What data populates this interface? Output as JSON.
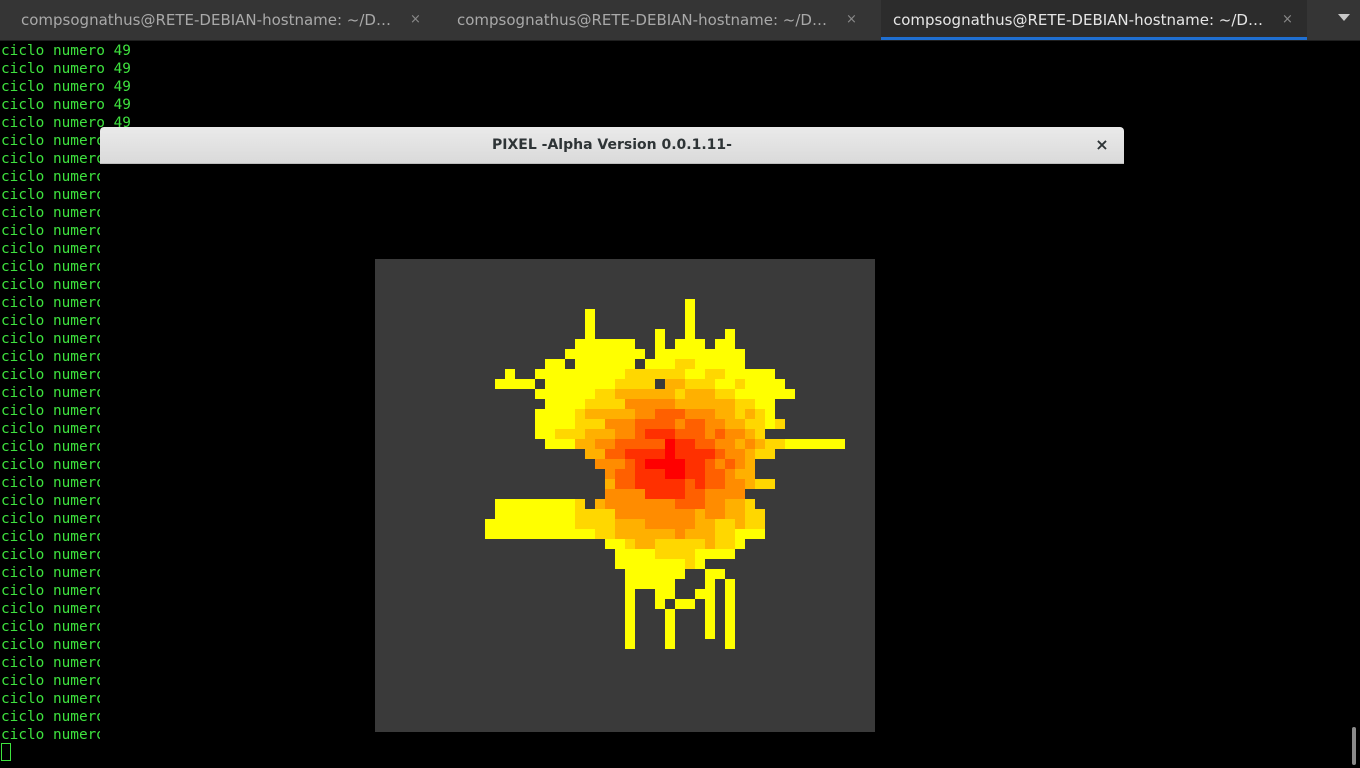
{
  "tabs": [
    {
      "title": "compsognathus@RETE-DEBIAN-hostname: ~/Docume…",
      "close": "×",
      "active": false
    },
    {
      "title": "compsognathus@RETE-DEBIAN-hostname: ~/Docume…",
      "close": "×",
      "active": false
    },
    {
      "title": "compsognathus@RETE-DEBIAN-hostname: ~/Docume…",
      "close": "×",
      "active": true
    }
  ],
  "terminal": {
    "line_text": "ciclo numero 49",
    "line_count": 39,
    "text_color": "#3ee23e",
    "background": "#000000"
  },
  "app_window": {
    "title": "PIXEL -Alpha Version 0.0.1.11-",
    "close": "×",
    "canvas_background": "#3a3a3a",
    "palette": [
      "#ffff00",
      "#ffd700",
      "#ffb000",
      "#ff8c00",
      "#ff6000",
      "#ff3000",
      "#ff0000"
    ]
  }
}
